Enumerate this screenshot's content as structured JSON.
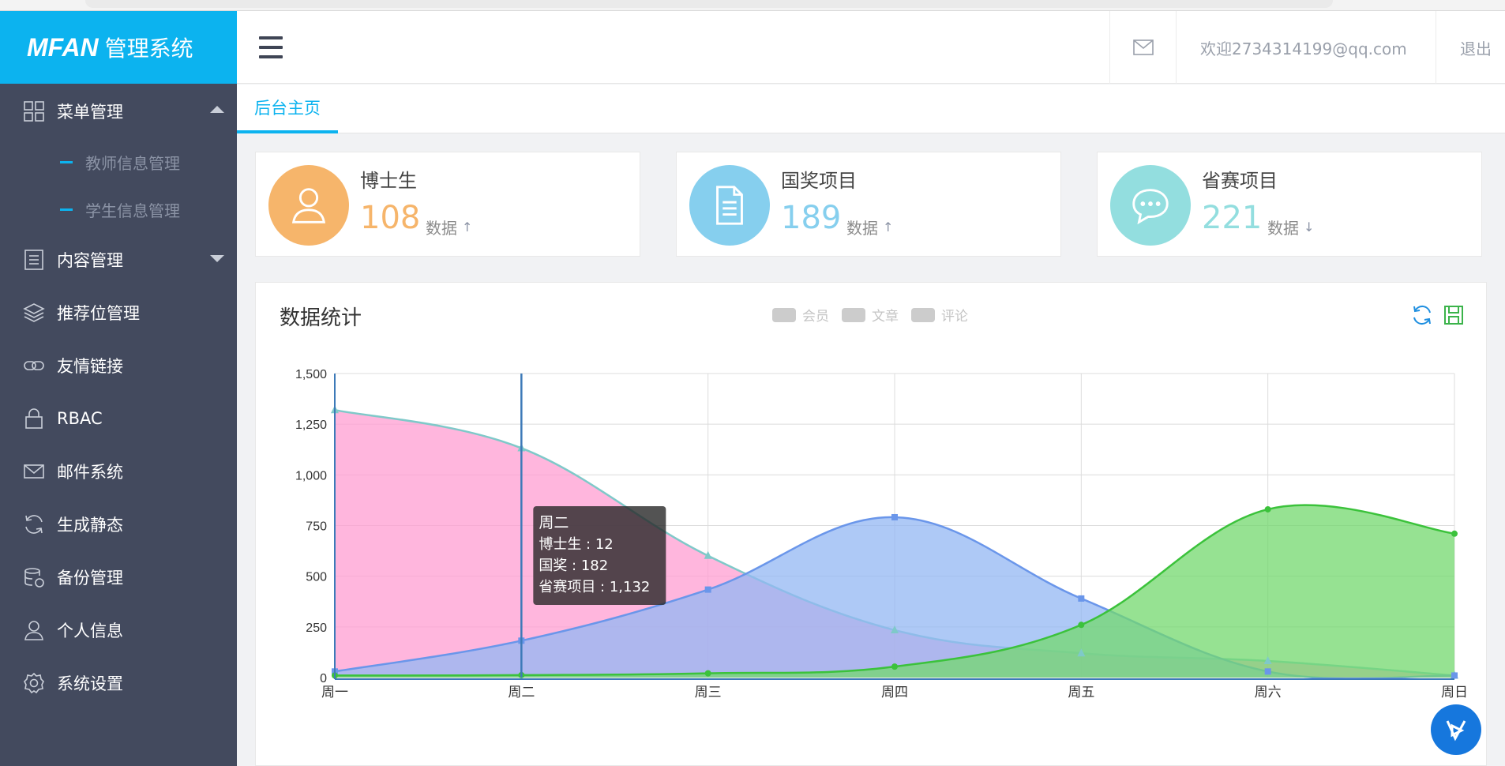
{
  "brand": {
    "logo": "MFAN",
    "name": "管理系统"
  },
  "sidebar": {
    "items": [
      {
        "label": "菜单管理",
        "icon": "grid-icon",
        "expanded": true,
        "children": [
          {
            "label": "教师信息管理"
          },
          {
            "label": "学生信息管理"
          }
        ]
      },
      {
        "label": "内容管理",
        "icon": "document-list-icon",
        "expanded": false
      },
      {
        "label": "推荐位管理",
        "icon": "layers-icon"
      },
      {
        "label": "友情链接",
        "icon": "link-icon"
      },
      {
        "label": "RBAC",
        "icon": "lock-icon"
      },
      {
        "label": "邮件系统",
        "icon": "mail-icon"
      },
      {
        "label": "生成静态",
        "icon": "refresh-icon"
      },
      {
        "label": "备份管理",
        "icon": "database-icon"
      },
      {
        "label": "个人信息",
        "icon": "user-icon"
      },
      {
        "label": "系统设置",
        "icon": "gear-icon"
      }
    ]
  },
  "header": {
    "mail_icon": "mail-icon",
    "welcome": "欢迎2734314199@qq.com",
    "logout": "退出"
  },
  "tabs": [
    {
      "label": "后台主页",
      "active": true
    }
  ],
  "stats": [
    {
      "title": "博士生",
      "value": "108",
      "unit": "数据",
      "trend": "↑",
      "color": "#f6b56b",
      "icon": "user-icon"
    },
    {
      "title": "国奖项目",
      "value": "189",
      "unit": "数据",
      "trend": "↑",
      "color": "#86cfee",
      "icon": "document-icon"
    },
    {
      "title": "省赛项目",
      "value": "221",
      "unit": "数据",
      "trend": "↓",
      "color": "#93dedf",
      "icon": "chat-bubble-icon"
    }
  ],
  "panel": {
    "title": "数据统计",
    "legend": [
      "会员",
      "文章",
      "评论"
    ],
    "tools": [
      "refresh-icon",
      "save-icon"
    ]
  },
  "tooltip": {
    "title": "周二",
    "lines": [
      "博士生 : 12",
      "国奖 : 182",
      "省赛项目 : 1,132"
    ]
  },
  "chart_data": {
    "type": "area",
    "categories": [
      "周一",
      "周二",
      "周三",
      "周四",
      "周五",
      "周六",
      "周日"
    ],
    "ylim": [
      0,
      1500
    ],
    "yticks": [
      "0",
      "250",
      "500",
      "750",
      "1,000",
      "1,250",
      "1,500"
    ],
    "yticks_values": [
      0,
      250,
      500,
      750,
      1000,
      1250,
      1500
    ],
    "grid": true,
    "series": [
      {
        "name": "省赛项目",
        "values": [
          1320,
          1132,
          601,
          234,
          120,
          82,
          10
        ],
        "fill": "#ff9ed1",
        "line": "#7fc9c9",
        "marker": "triangle"
      },
      {
        "name": "国奖",
        "values": [
          30,
          182,
          434,
          791,
          390,
          30,
          10
        ],
        "fill": "#93b7f3",
        "line": "#6a96ea",
        "marker": "square"
      },
      {
        "name": "博士生",
        "values": [
          10,
          12,
          21,
          54,
          260,
          830,
          710
        ],
        "fill": "#73d86e",
        "line": "#3bc23b",
        "marker": "circle"
      }
    ],
    "highlight_category": "周二"
  },
  "float_badge": {
    "icon": "play-assist-icon"
  }
}
